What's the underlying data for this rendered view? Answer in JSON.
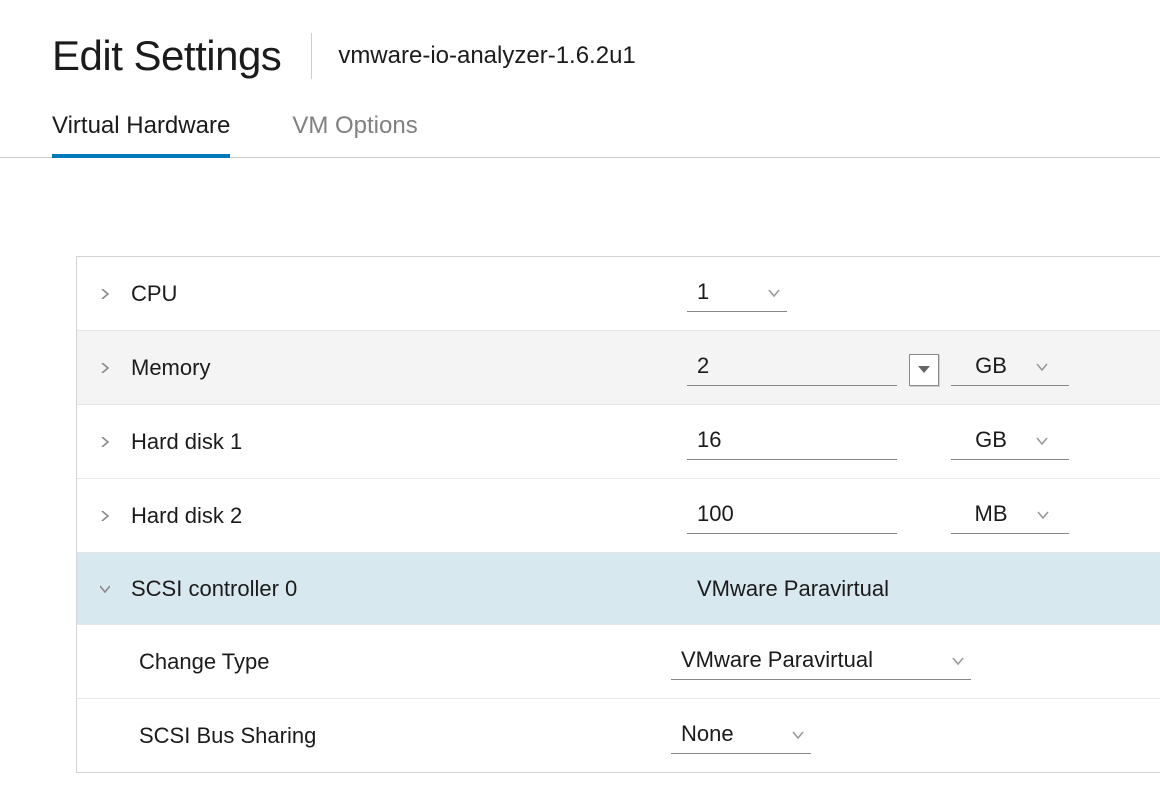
{
  "header": {
    "title": "Edit Settings",
    "subtitle": "vmware-io-analyzer-1.6.2u1"
  },
  "tabs": {
    "hardware": "Virtual Hardware",
    "options": "VM Options"
  },
  "rows": {
    "cpu": {
      "label": "CPU",
      "value": "1"
    },
    "memory": {
      "label": "Memory",
      "value": "2",
      "unit": "GB"
    },
    "hd1": {
      "label": "Hard disk 1",
      "value": "16",
      "unit": "GB"
    },
    "hd2": {
      "label": "Hard disk 2",
      "value": "100",
      "unit": "MB"
    },
    "scsi": {
      "label": "SCSI controller 0",
      "summary": "VMware Paravirtual",
      "changeTypeLabel": "Change Type",
      "changeTypeValue": "VMware Paravirtual",
      "busSharingLabel": "SCSI Bus Sharing",
      "busSharingValue": "None"
    }
  }
}
